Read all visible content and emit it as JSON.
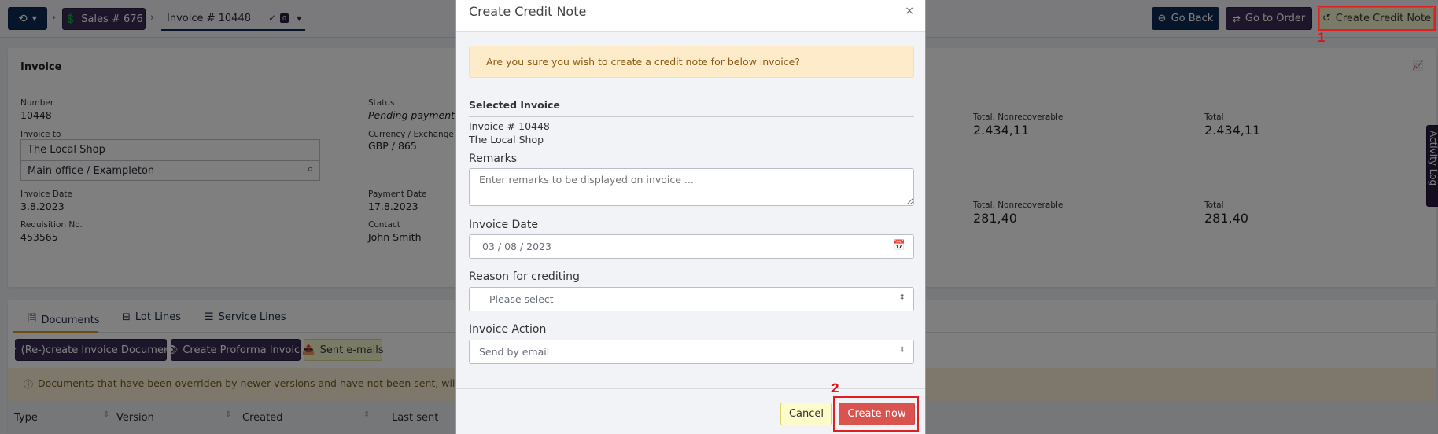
{
  "topbar": {
    "history_label": "",
    "sales_label": "Sales # 676",
    "invoice_tab_label": "Invoice # 10448",
    "check_count": "0",
    "go_back_label": "Go Back",
    "go_to_order_label": "Go to Order",
    "create_credit_note_label": "Create Credit Note"
  },
  "invoice_card": {
    "title": "Invoice",
    "number_label": "Number",
    "number_value": "10448",
    "status_label": "Status",
    "status_value": "Pending payment",
    "invoice_to_label": "Invoice to",
    "invoice_to_name": "The Local Shop",
    "invoice_to_address": "Main office / Exampleton",
    "currency_label": "Currency / Exchange rate",
    "currency_value": "GBP / 865",
    "invoice_date_label": "Invoice Date",
    "invoice_date_value": "3.8.2023",
    "payment_date_label": "Payment Date",
    "payment_date_value": "17.8.2023",
    "requisition_label": "Requisition No.",
    "requisition_value": "453565",
    "contact_label": "Contact",
    "contact_value": "John Smith",
    "totals": [
      {
        "nonrec_label": "Total, Nonrecoverable",
        "nonrec_value": "2.434,11",
        "total_label": "Total",
        "total_value": "2.434,11"
      },
      {
        "nonrec_label": "Total, Nonrecoverable",
        "nonrec_value": "281,40",
        "total_label": "Total",
        "total_value": "281,40"
      }
    ]
  },
  "activity_log_label": "Activity Log",
  "documents": {
    "tabs": [
      {
        "label": "Documents",
        "icon": "document-icon",
        "active": true
      },
      {
        "label": "Lot Lines",
        "icon": "box-icon",
        "active": false
      },
      {
        "label": "Service Lines",
        "icon": "list-icon",
        "active": false
      }
    ],
    "recreate_label": "(Re-)create Invoice Document",
    "proforma_label": "Create Proforma Invoice",
    "sent_emails_label": "Sent e-mails",
    "alert_text": "Documents that have been overriden by newer versions and have not been sent, will be d",
    "table_headers": [
      "Type",
      "Version",
      "Created",
      "Last sent"
    ]
  },
  "modal": {
    "title": "Create Credit Note",
    "close_symbol": "×",
    "warning": "Are you sure you wish to create a credit note for below invoice?",
    "selected_invoice_heading": "Selected Invoice",
    "selected_invoice_number": "Invoice # 10448",
    "selected_invoice_customer": "The Local Shop",
    "remarks_label": "Remarks",
    "remarks_placeholder": "Enter remarks to be displayed on invoice ...",
    "invoice_date_label": "Invoice Date",
    "invoice_date_value": "03 / 08 / 2023",
    "reason_label": "Reason for crediting",
    "reason_value": "-- Please select --",
    "action_label": "Invoice Action",
    "action_value": "Send by email",
    "cancel_label": "Cancel",
    "create_label": "Create now"
  },
  "annotations": {
    "step1": "1",
    "step2": "2"
  },
  "colors": {
    "navy": "#0c2a55",
    "purple": "#3b2a55",
    "danger": "#d9534f",
    "warning_bg": "#fdebc9",
    "annotation": "#e02020"
  }
}
